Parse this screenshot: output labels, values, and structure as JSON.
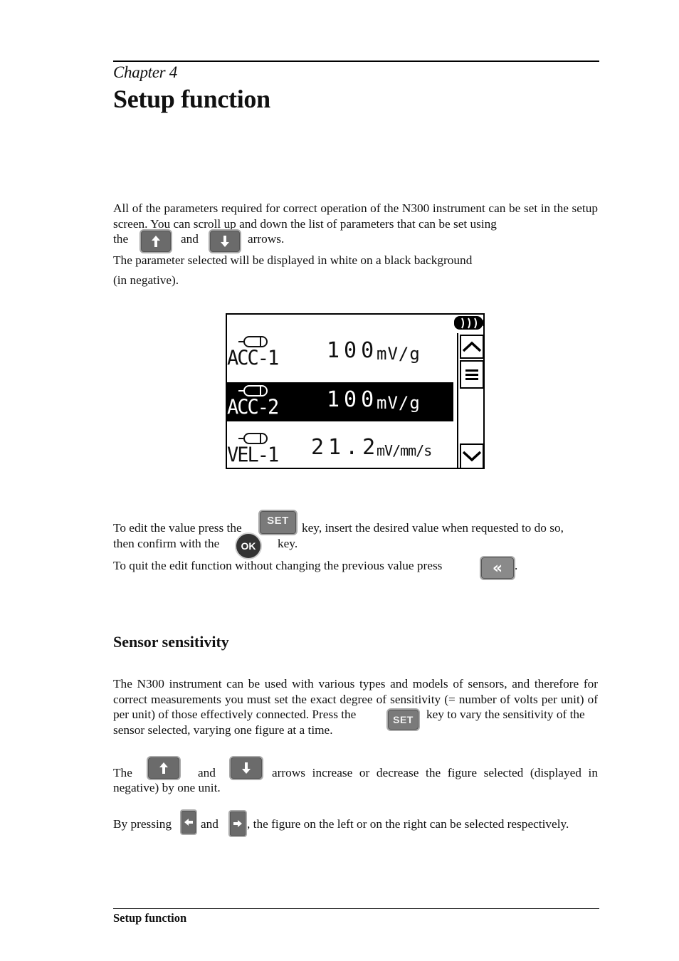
{
  "header": {
    "chapter": "Chapter 4",
    "title": "Setup function"
  },
  "intro": {
    "line1": "All of the parameters required for correct operation of the N300 instrument can be set in the setup screen. You can scroll up and down the list of parameters that can be set using",
    "line2_start": "the",
    "line2_and": "and",
    "line2_end": "arrows.",
    "line3": "The parameter selected will be displayed in white on a black background",
    "line4": "(in negative)."
  },
  "keys": {
    "up": "arrow-up-key",
    "down": "arrow-down-key",
    "left": "arrow-left-key",
    "right": "arrow-right-key",
    "set_label": "SET",
    "ok_label": "OK",
    "back_label": "«"
  },
  "lcd": {
    "rows": [
      {
        "name": "ACC-1",
        "value": "100",
        "unit": "mV/g",
        "selected": false
      },
      {
        "name": "ACC-2",
        "value": "100",
        "unit": "mV/g",
        "selected": true
      },
      {
        "name": "VEL-1",
        "value": "21.2",
        "unit": "mV/mm/s",
        "selected": false
      }
    ],
    "battery_icon": "battery-icon",
    "scroll_up_icon": "chevron-up-icon",
    "menu_icon": "menu-icon",
    "scroll_down_icon": "chevron-down-icon"
  },
  "edit": {
    "l1_a": "To edit the value press the",
    "l1_b": "key, insert the desired value when requested to do so,",
    "l2_a": "then confirm with the",
    "l2_b": "key.",
    "l3_a": "To quit the edit function without changing the previous value press",
    "l3_b": "."
  },
  "sensor": {
    "heading": "Sensor sensitivity",
    "p1_a": "The N300 instrument can be used with various types and models of sensors, and therefore for correct measurements you must set the exact degree of sensitivity (= number of volts per unit) of those effectively connected. Press the",
    "p1_b": "key to vary the sensitivity of the",
    "p1_c": "sensor selected, varying one figure at a time.",
    "p2_a": "The",
    "p2_b": "and",
    "p2_c": "arrows increase or decrease the figure selected (displayed in",
    "p2_d": "negative) by one unit.",
    "p3_a": "By pressing",
    "p3_b": "and",
    "p3_c": ", the figure on the left or on the right can be selected respectively."
  },
  "footer": {
    "text": "Setup function"
  }
}
